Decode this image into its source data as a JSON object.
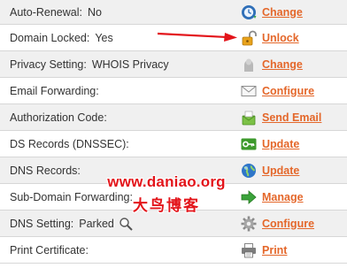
{
  "rows": [
    {
      "label": "Auto-Renewal:",
      "value": "No",
      "action": "Change",
      "icon": "clock-refresh-icon"
    },
    {
      "label": "Domain Locked:",
      "value": "Yes",
      "action": "Unlock",
      "icon": "open-lock-icon"
    },
    {
      "label": "Privacy Setting:",
      "value": "WHOIS Privacy",
      "action": "Change",
      "icon": "privacy-mask-icon"
    },
    {
      "label": "Email Forwarding:",
      "value": "",
      "action": "Configure",
      "icon": "envelope-icon"
    },
    {
      "label": "Authorization Code:",
      "value": "",
      "action": "Send Email",
      "icon": "send-email-icon"
    },
    {
      "label": "DS Records (DNSSEC):",
      "value": "",
      "action": "Update",
      "icon": "key-icon"
    },
    {
      "label": "DNS Records:",
      "value": "",
      "action": "Update",
      "icon": "globe-icon"
    },
    {
      "label": "Sub-Domain Forwarding:",
      "value": "",
      "action": "Manage",
      "icon": "green-arrow-icon"
    },
    {
      "label": "DNS Setting:",
      "value": "Parked",
      "action": "Configure",
      "icon": "gear-icon"
    },
    {
      "label": "Print Certificate:",
      "value": "",
      "action": "Print",
      "icon": "printer-icon"
    }
  ],
  "watermark": {
    "url": "www.daniao.org",
    "cn": "大鸟博客"
  },
  "colors": {
    "action": "#e4672a",
    "row_alt": "#f0f0f0",
    "annotation_arrow": "#e3141a",
    "watermark": "#e3141a"
  }
}
